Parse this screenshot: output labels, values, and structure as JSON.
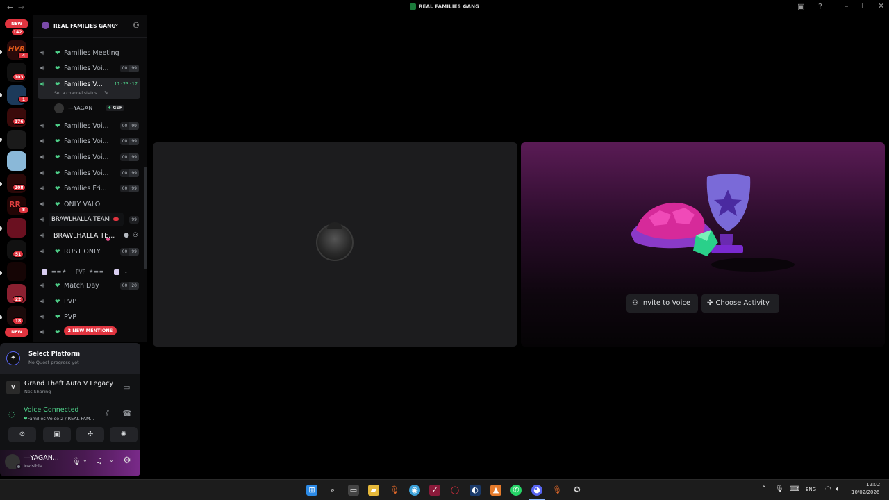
{
  "window": {
    "title": "REAL FAMILIES GANG"
  },
  "rail": {
    "top_new": "NEW",
    "top_count": "142",
    "bottom_new": "NEW",
    "servers": [
      {
        "badge": "4"
      },
      {
        "badge": "103"
      },
      {
        "badge": "1"
      },
      {
        "badge": "176"
      },
      {
        "badge": ""
      },
      {
        "badge": ""
      },
      {
        "badge": "208"
      },
      {
        "badge": "8"
      },
      {
        "badge": ""
      },
      {
        "badge": "51"
      },
      {
        "badge": ""
      },
      {
        "badge": "22"
      },
      {
        "badge": "18"
      }
    ]
  },
  "sidebar": {
    "server_name": "REAL FAMILIES GANG",
    "channels": [
      {
        "name": "Families Meeting",
        "heart": true,
        "count": "",
        "limit": ""
      },
      {
        "name": "Families Voi...",
        "heart": true,
        "count": "00",
        "limit": "99"
      },
      {
        "name": "Families V...",
        "heart": true,
        "count": "",
        "limit": "",
        "timer": "11:23:17",
        "status": "Set a channel status",
        "active": true
      },
      {
        "name": "Families Voi...",
        "heart": true,
        "count": "00",
        "limit": "99"
      },
      {
        "name": "Families Voi...",
        "heart": true,
        "count": "00",
        "limit": "99"
      },
      {
        "name": "Families Voi...",
        "heart": true,
        "count": "00",
        "limit": "99"
      },
      {
        "name": "Families Voi...",
        "heart": true,
        "count": "00",
        "limit": "99"
      },
      {
        "name": "Families Fri...",
        "heart": true,
        "count": "00",
        "limit": "99"
      },
      {
        "name": "ONLY VALO",
        "heart": true,
        "count": "",
        "limit": ""
      },
      {
        "name": "",
        "heart": false,
        "count": "",
        "limit": "99"
      },
      {
        "name": "BRAWLHALLA TE...",
        "heart": false,
        "count": "",
        "limit": ""
      },
      {
        "name": "RUST ONLY",
        "heart": true,
        "count": "00",
        "limit": "99"
      },
      {
        "name": "Match Day",
        "heart": true,
        "count": "00",
        "limit": "20"
      },
      {
        "name": "PVP",
        "heart": true,
        "count": "",
        "limit": ""
      },
      {
        "name": "PVP",
        "heart": true,
        "count": "",
        "limit": ""
      }
    ],
    "voice_user": "—YAGAN",
    "voice_user_tag": "GSF",
    "tooltip": "BRAWLHALLA TEAM",
    "category": "PVP",
    "mentions_pill": "2 NEW MENTIONS"
  },
  "panel": {
    "quest_title": "Select Platform",
    "quest_sub": "No Quest progress yet",
    "game_title": "Grand Theft Auto V Legacy",
    "game_sub": "Not Sharing",
    "voice_status": "Voice Connected",
    "voice_channel": "Families Voice 2 / REAL FAM...",
    "user_name": "—YAGAN...",
    "user_status": "Invisible"
  },
  "main": {
    "invite_label": "Invite to Voice",
    "activity_label": "Choose Activity"
  },
  "taskbar": {
    "lang": "ENG",
    "time": "12:02",
    "date": "10/02/2026"
  },
  "colors": {
    "accent_red": "#e0343f",
    "online_green": "#4fd18a",
    "activity_purple": "#5a1b55"
  }
}
